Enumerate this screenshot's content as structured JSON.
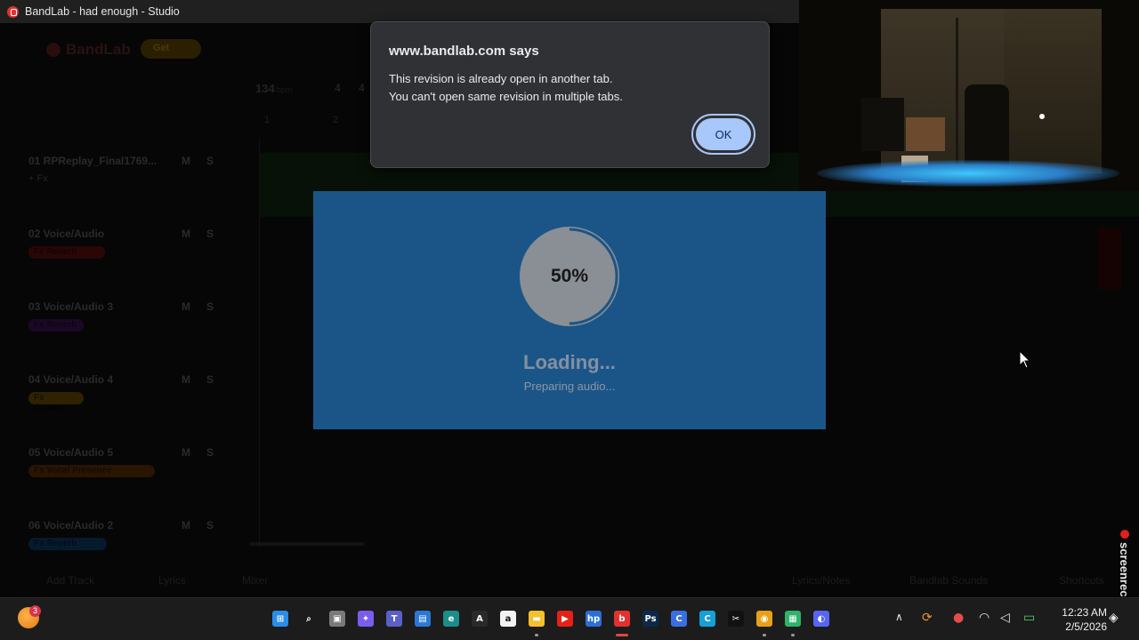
{
  "window": {
    "title": "BandLab - had enough - Studio"
  },
  "studio": {
    "logo_text": "BandLab",
    "badge": "Get",
    "tempo": "134",
    "tempo_unit": "bpm",
    "time_sig_top": "4",
    "time_sig_bottom": "4",
    "bars": [
      "1",
      "2"
    ],
    "tracks": [
      {
        "name": "01  RPReplay_Final1769...",
        "mute": "M",
        "solo": "S",
        "fx": "+ Fx",
        "fx_color": ""
      },
      {
        "name": "02  Voice/Audio",
        "mute": "M",
        "solo": "S",
        "fx": "Fx Reverb",
        "fx_color": "#2a0606"
      },
      {
        "name": "03  Voice/Audio 3",
        "mute": "M",
        "solo": "S",
        "fx": "Fx Reverb",
        "fx_color": "#1c0826"
      },
      {
        "name": "04  Voice/Audio 4",
        "mute": "M",
        "solo": "S",
        "fx": "Fx Custom",
        "fx_color": "#2e2200"
      },
      {
        "name": "05  Voice/Audio 5",
        "mute": "M",
        "solo": "S",
        "fx": "Fx Vocal Presence",
        "fx_color": "#2a1500"
      },
      {
        "name": "06  Voice/Audio 2",
        "mute": "M",
        "solo": "S",
        "fx": "Fx Reverb",
        "fx_color": "#061a2e"
      }
    ],
    "bottom": {
      "left1": "Add Track",
      "left2": "Lyrics",
      "left3": "Mixer",
      "lyrics_notes": "Lyrics/Notes",
      "bandlab_sounds": "Bandlab Sounds",
      "shortcuts": "Shortcuts"
    }
  },
  "dialog": {
    "origin": "www.bandlab.com says",
    "line1": "This revision is already open in another tab.",
    "line2": "You can't open same revision in multiple tabs.",
    "ok_label": "OK"
  },
  "loading": {
    "percent_label": "50%",
    "progress": 0.5,
    "title": "Loading...",
    "subtitle": "Preparing audio..."
  },
  "screenrec": {
    "label": "screenrec"
  },
  "taskbar": {
    "weather_badge": "3",
    "apps": [
      {
        "name": "start-icon",
        "glyph": "⊞",
        "color": "#2b8de8"
      },
      {
        "name": "search-icon",
        "glyph": "⌕",
        "color": ""
      },
      {
        "name": "task-view-icon",
        "glyph": "▣",
        "color": "#7a7a7a"
      },
      {
        "name": "copilot-icon",
        "glyph": "✦",
        "color": "#7b5cf0"
      },
      {
        "name": "teams-icon",
        "glyph": "T",
        "color": "#5b5fc7"
      },
      {
        "name": "store-icon",
        "glyph": "▤",
        "color": "#2b78d4"
      },
      {
        "name": "edge-icon",
        "glyph": "e",
        "color": "#1a8e8a"
      },
      {
        "name": "affinity-icon",
        "glyph": "A",
        "color": "#2a2a2a"
      },
      {
        "name": "amazon-icon",
        "glyph": "a",
        "color": "#f2f2f2"
      },
      {
        "name": "file-explorer-icon",
        "glyph": "▬",
        "color": "#f3c02f"
      },
      {
        "name": "youtube-icon",
        "glyph": "▶",
        "color": "#e62117"
      },
      {
        "name": "hp-icon",
        "glyph": "hp",
        "color": "#2b6fd4"
      },
      {
        "name": "bandlab-icon",
        "glyph": "b",
        "color": "#e0322f"
      },
      {
        "name": "photoshop-icon",
        "glyph": "Ps",
        "color": "#0b2a4a"
      },
      {
        "name": "canva-icon",
        "glyph": "C",
        "color": "#3b6fe0"
      },
      {
        "name": "canva-alt-icon",
        "glyph": "C",
        "color": "#18a0d6"
      },
      {
        "name": "capcut-icon",
        "glyph": "✂",
        "color": "#111111"
      },
      {
        "name": "chrome-icon",
        "glyph": "◉",
        "color": "#e6a118"
      },
      {
        "name": "android-icon",
        "glyph": "▦",
        "color": "#2fb36b"
      },
      {
        "name": "discord-icon",
        "glyph": "◐",
        "color": "#5865f2"
      }
    ],
    "time": "12:23 AM",
    "date": "2/5/2026"
  }
}
